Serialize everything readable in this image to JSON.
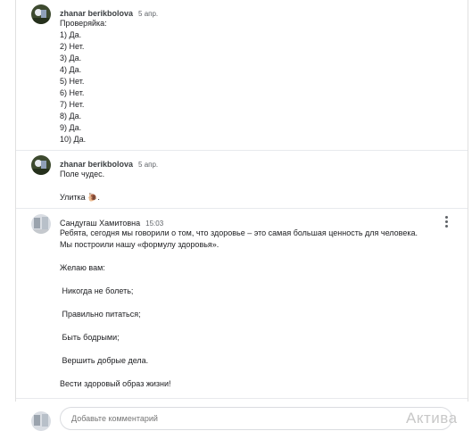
{
  "comments": [
    {
      "author": "zhanar berikbolova",
      "time": "5 апр.",
      "body": "Проверяйка:\n1) Да.\n2) Нет.\n3) Да.\n4) Да.\n5) Нет.\n6) Нет.\n7) Нет.\n8) Да.\n9) Да.\n10) Да."
    },
    {
      "author": "zhanar berikbolova",
      "time": "5 апр.",
      "body": "Поле чудес.\n\nУлитка 🐌."
    },
    {
      "author": "Сандугаш Хамитовна",
      "time": "15:03",
      "body": "Ребята, сегодня мы говорили о том, что здоровье – это самая большая ценность для человека.\nМы построили нашу «формулу здоровья».\n\nЖелаю вам:\n\n Никогда не болеть;\n\n Правильно питаться;\n\n Быть бодрыми;\n\n Вершить добрые дела.\n\nВести здоровый образ жизни!"
    }
  ],
  "reply": {
    "placeholder": "Добавьте комментарий"
  },
  "watermark": "Актива",
  "icons": {
    "avatar_1": "user-photo-avatar",
    "avatar_2": "user-photo-avatar",
    "avatar_3": "user-photo-avatar",
    "more": "more-vert-icon"
  }
}
